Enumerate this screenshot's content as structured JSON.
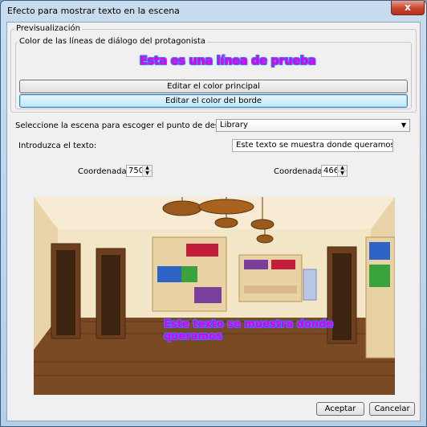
{
  "window": {
    "title": "Efecto para mostrar texto en la escena",
    "close_label": "x"
  },
  "preview_group": {
    "legend": "Previsualización"
  },
  "color_group": {
    "legend": "Color de las líneas de diálogo del protagonista",
    "sample_text": "Esta es una línea de prueba",
    "edit_main_label": "Editar el color principal",
    "edit_border_label": "Editar el color del borde"
  },
  "scene_select": {
    "label": "Seleccione la escena para escoger el punto de destino:",
    "value": "Library"
  },
  "text_input": {
    "label": "Introduzca el texto:",
    "value": "Este texto se muestra donde queramos"
  },
  "coord_x": {
    "label": "Coordenada X",
    "value": "750"
  },
  "coord_y": {
    "label": "Coordenada Y",
    "value": "466"
  },
  "scene_preview": {
    "overlay_text": "Este texto se muestra donde queramos"
  },
  "footer": {
    "accept_label": "Aceptar",
    "cancel_label": "Cancelar"
  },
  "colors": {
    "text_main": "#e100e1",
    "text_border": "#4a6cff"
  }
}
